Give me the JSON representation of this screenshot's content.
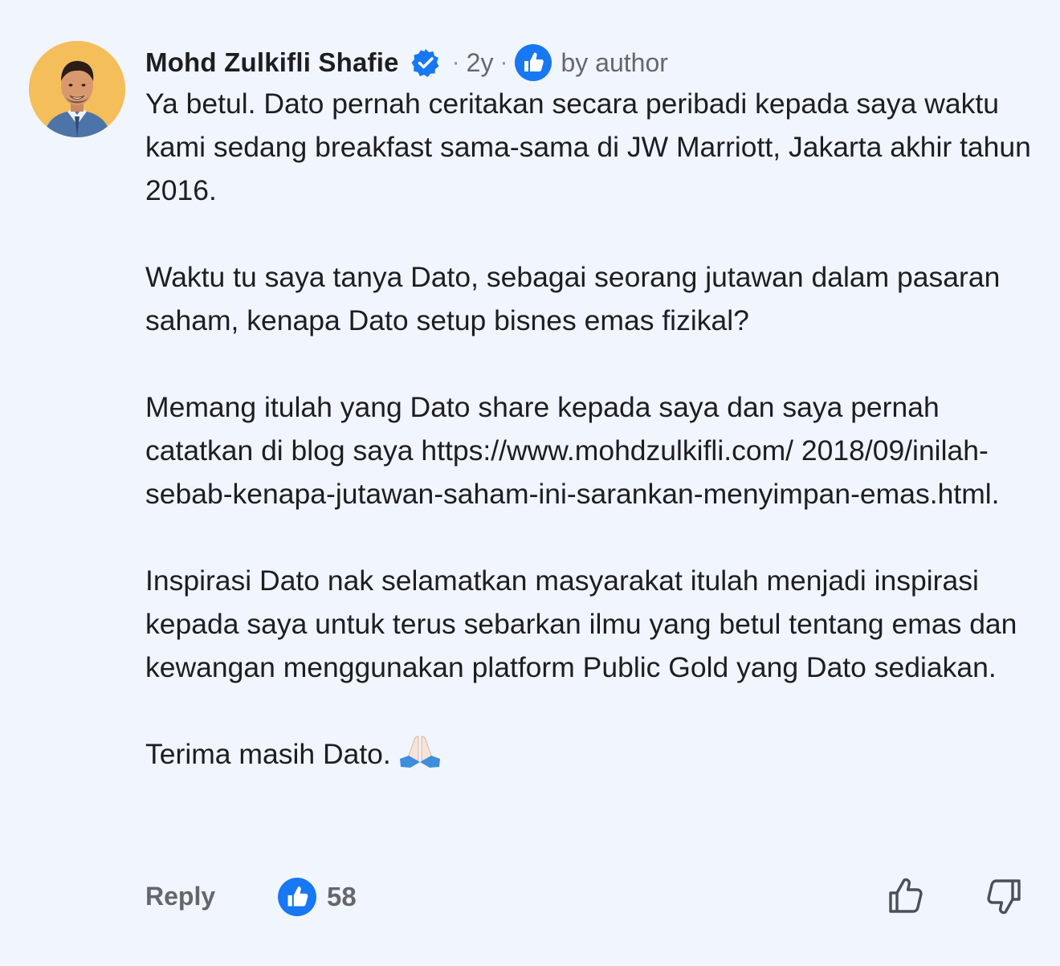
{
  "comment": {
    "author": {
      "name": "Mohd Zulkifli Shafie",
      "verified": true,
      "avatar_bg": "#F4BE5B"
    },
    "meta": {
      "separator": "·",
      "time": "2y",
      "author_like_icon": "thumbs-up-badge-icon",
      "liked_by": "by author"
    },
    "paragraphs": [
      "Ya betul. Dato pernah ceritakan secara peribadi kepada saya waktu kami sedang breakfast sama-sama di JW Marriott, Jakarta akhir tahun 2016.",
      "Waktu tu saya tanya Dato, sebagai seorang jutawan dalam pasaran saham, kenapa Dato setup bisnes emas fizikal?",
      "Memang itulah yang Dato share kepada saya dan saya pernah catatkan di blog saya https://www.mohdzulkifli.com/ 2018/09/inilah-sebab-kenapa-jutawan-saham-ini-sarankan-menyimpan-emas.html.",
      "Inspirasi Dato nak selamatkan masyarakat itulah menjadi inspirasi kepada saya untuk terus sebarkan ilmu yang betul tentang emas dan kewangan menggunakan platform Public Gold yang Dato sediakan.",
      "Terima masih Dato."
    ],
    "emoji": "folded-hands-emoji",
    "actions": {
      "reply_label": "Reply",
      "reaction_icon": "thumbs-up-badge-icon",
      "reaction_count": "58",
      "like_icon": "thumbs-up-outline-icon",
      "dislike_icon": "thumbs-down-outline-icon"
    },
    "colors": {
      "background": "#F1F5FD",
      "accent": "#1877F2",
      "muted_text": "#65676B"
    }
  }
}
